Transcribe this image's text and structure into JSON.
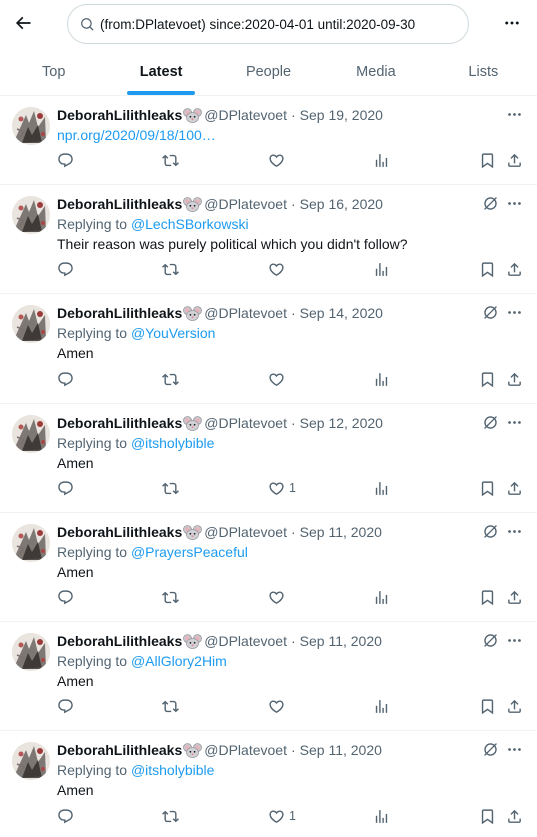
{
  "search": {
    "query": "(from:DPlatevoet) since:2020-04-01 until:2020-09-30"
  },
  "tabs": [
    {
      "label": "Top",
      "active": false
    },
    {
      "label": "Latest",
      "active": true
    },
    {
      "label": "People",
      "active": false
    },
    {
      "label": "Media",
      "active": false
    },
    {
      "label": "Lists",
      "active": false
    }
  ],
  "colors": {
    "accent": "#1d9bf0",
    "text": "#0f1419",
    "secondary": "#536471",
    "border": "#eff3f4"
  },
  "tweets": [
    {
      "name": "DeborahLilithleaks",
      "handle": "@DPlatevoet",
      "date": "Sep 19, 2020",
      "link": "npr.org/2020/09/18/100…",
      "like_count": ""
    },
    {
      "name": "DeborahLilithleaks",
      "handle": "@DPlatevoet",
      "date": "Sep 16, 2020",
      "reply_prefix": "Replying to ",
      "reply_to": "@LechSBorkowski",
      "text": "Their reason was purely political which you didn't follow?",
      "like_count": ""
    },
    {
      "name": "DeborahLilithleaks",
      "handle": "@DPlatevoet",
      "date": "Sep 14, 2020",
      "reply_prefix": "Replying to ",
      "reply_to": "@YouVersion",
      "text": "Amen",
      "like_count": ""
    },
    {
      "name": "DeborahLilithleaks",
      "handle": "@DPlatevoet",
      "date": "Sep 12, 2020",
      "reply_prefix": "Replying to ",
      "reply_to": "@itsholybible",
      "text": "Amen",
      "like_count": "1"
    },
    {
      "name": "DeborahLilithleaks",
      "handle": "@DPlatevoet",
      "date": "Sep 11, 2020",
      "reply_prefix": "Replying to ",
      "reply_to": "@PrayersPeaceful",
      "text": "Amen",
      "like_count": ""
    },
    {
      "name": "DeborahLilithleaks",
      "handle": "@DPlatevoet",
      "date": "Sep 11, 2020",
      "reply_prefix": "Replying to ",
      "reply_to": "@AllGlory2Him",
      "text": "Amen",
      "like_count": ""
    },
    {
      "name": "DeborahLilithleaks",
      "handle": "@DPlatevoet",
      "date": "Sep 11, 2020",
      "reply_prefix": "Replying to ",
      "reply_to": "@itsholybible",
      "text": "Amen",
      "like_count": "1"
    }
  ],
  "icons": [
    "back-arrow-icon",
    "search-icon",
    "more-icon",
    "mouse-emoji-icon",
    "grok-icon",
    "caret-icon",
    "reply-icon",
    "retweet-icon",
    "like-icon",
    "views-icon",
    "bookmark-icon",
    "share-icon"
  ]
}
